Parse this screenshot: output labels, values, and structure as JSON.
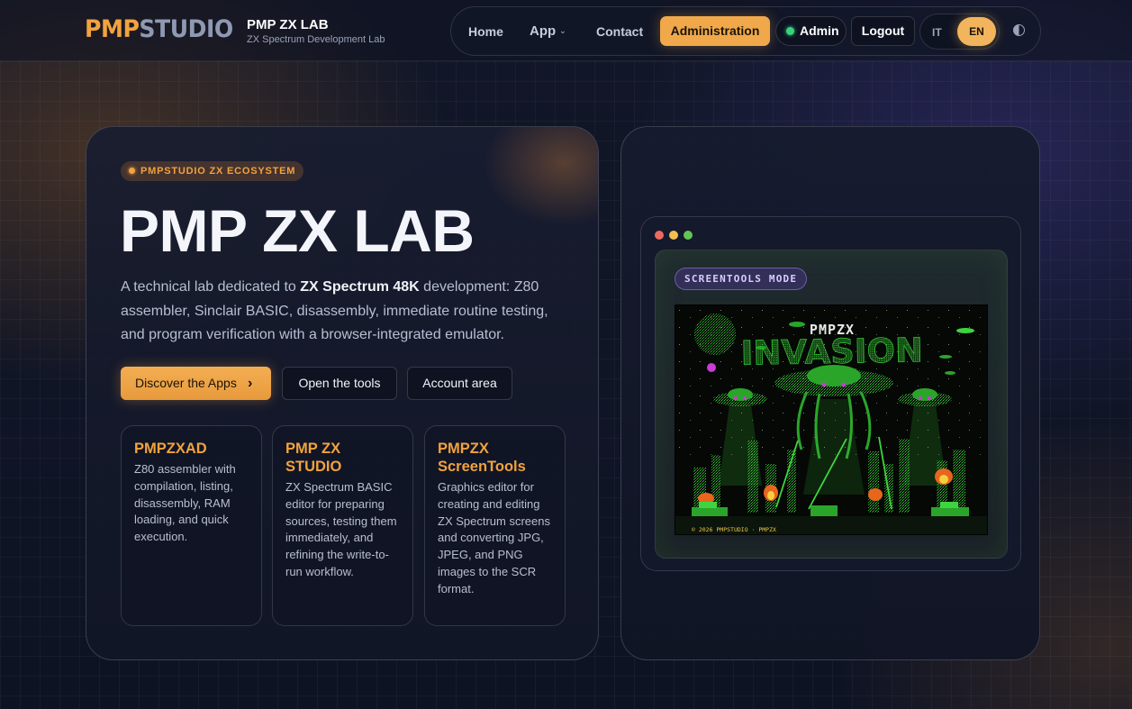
{
  "brand": {
    "logo_part1": "PMP",
    "logo_part2": "STUDIO",
    "title": "PMP ZX LAB",
    "subtitle": "ZX Spectrum Development Lab"
  },
  "nav": {
    "home": "Home",
    "app": "App",
    "contact": "Contact",
    "administration": "Administration",
    "user": "Admin",
    "logout": "Logout",
    "lang_it": "IT",
    "lang_en": "EN",
    "active_lang": "EN"
  },
  "hero": {
    "badge": "PMPSTUDIO ZX ECOSYSTEM",
    "title": "PMP ZX LAB",
    "desc_pre": "A technical lab dedicated to ",
    "desc_bold": "ZX Spectrum 48K",
    "desc_post": " development: Z80 assembler, Sinclair BASIC, disassembly, immediate routine testing, and program verification with a browser-integrated emulator.",
    "cta_discover": "Discover the Apps",
    "cta_discover_arrow": "›",
    "cta_tools": "Open the tools",
    "cta_account": "Account area"
  },
  "apps": [
    {
      "title": "PMPZXAD",
      "desc": "Z80 assembler with compilation, listing, disassembly, RAM loading, and quick execution."
    },
    {
      "title": "PMP ZX STUDIO",
      "desc": "ZX Spectrum BASIC editor for preparing sources, testing them immediately, and refining the write-to-run workflow."
    },
    {
      "title": "PMPZX ScreenTools",
      "desc": "Graphics editor for creating and editing ZX Spectrum screens and converting JPG, JPEG, and PNG images to the SCR format."
    }
  ],
  "preview": {
    "mode_tag": "SCREENTOOLS MODE",
    "game_title_small": "PMPZX",
    "game_title_big": "INVASION",
    "copyright": "© 2026 PMPSTUDIO · PMPZX"
  },
  "colors": {
    "accent": "#f2a23e",
    "logo_secondary": "#8f99b2",
    "window_red": "#ed6a5e",
    "window_yellow": "#f4bf4f",
    "window_green": "#61c554",
    "screen_green": "#3fd43f",
    "screen_magenta": "#c83cd8"
  }
}
